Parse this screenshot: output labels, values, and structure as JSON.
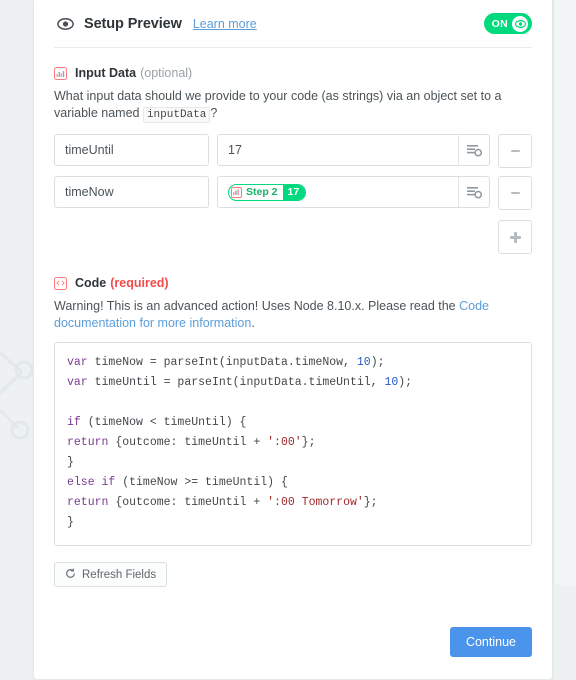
{
  "header": {
    "eye_icon": "eye-icon",
    "title": "Setup Preview",
    "learn_more": "Learn more",
    "toggle_label": "ON",
    "toggle_icon": "eye-icon",
    "toggle_color": "#00d97e"
  },
  "input_data": {
    "icon": "chart-bars-icon",
    "title": "Input Data",
    "optional_note": "(optional)",
    "help_part1": "What input data should we provide to your code (as strings) via an object set to a variable named",
    "help_code": "inputData",
    "help_part2": "?",
    "rows": [
      {
        "key": "timeUntil",
        "value_type": "text",
        "value": "17",
        "insert_icon": "list-settings-icon",
        "remove_icon": "minus-icon"
      },
      {
        "key": "timeNow",
        "value_type": "token",
        "token_icon": "step-icon",
        "token_label": "Step 2",
        "token_value": "17",
        "insert_icon": "list-settings-icon",
        "remove_icon": "minus-icon"
      }
    ],
    "add_icon": "plus-icon"
  },
  "code_section": {
    "icon": "code-brackets-icon",
    "title": "Code",
    "required_note": "(required)",
    "warning_part1": "Warning! This is an advanced action! Uses Node 8.10.x. Please read the",
    "warning_link": "Code documentation for more information",
    "warning_part2": ".",
    "code_lines": [
      [
        {
          "t": "var",
          "c": "kw"
        },
        {
          "t": " timeNow = parseInt(inputData.timeNow, ",
          "c": ""
        },
        {
          "t": "10",
          "c": "num"
        },
        {
          "t": ");",
          "c": ""
        }
      ],
      [
        {
          "t": "var",
          "c": "kw"
        },
        {
          "t": " timeUntil = parseInt(inputData.timeUntil, ",
          "c": ""
        },
        {
          "t": "10",
          "c": "num"
        },
        {
          "t": ");",
          "c": ""
        }
      ],
      [],
      [
        {
          "t": "if",
          "c": "kw"
        },
        {
          "t": " (timeNow < timeUntil) {",
          "c": ""
        }
      ],
      [
        {
          "t": "return",
          "c": "kw"
        },
        {
          "t": " {outcome: timeUntil + ",
          "c": ""
        },
        {
          "t": "':00'",
          "c": "str"
        },
        {
          "t": "};",
          "c": ""
        }
      ],
      [
        {
          "t": "}",
          "c": ""
        }
      ],
      [
        {
          "t": "else if",
          "c": "kw"
        },
        {
          "t": " (timeNow >= timeUntil) {",
          "c": ""
        }
      ],
      [
        {
          "t": "return",
          "c": "kw"
        },
        {
          "t": " {outcome: timeUntil + ",
          "c": ""
        },
        {
          "t": "':00 Tomorrow'",
          "c": "str"
        },
        {
          "t": "};",
          "c": ""
        }
      ],
      [
        {
          "t": "}",
          "c": ""
        }
      ]
    ]
  },
  "footer": {
    "refresh_icon": "refresh-icon",
    "refresh_label": "Refresh Fields",
    "continue_label": "Continue",
    "continue_color": "#4a94ec"
  }
}
